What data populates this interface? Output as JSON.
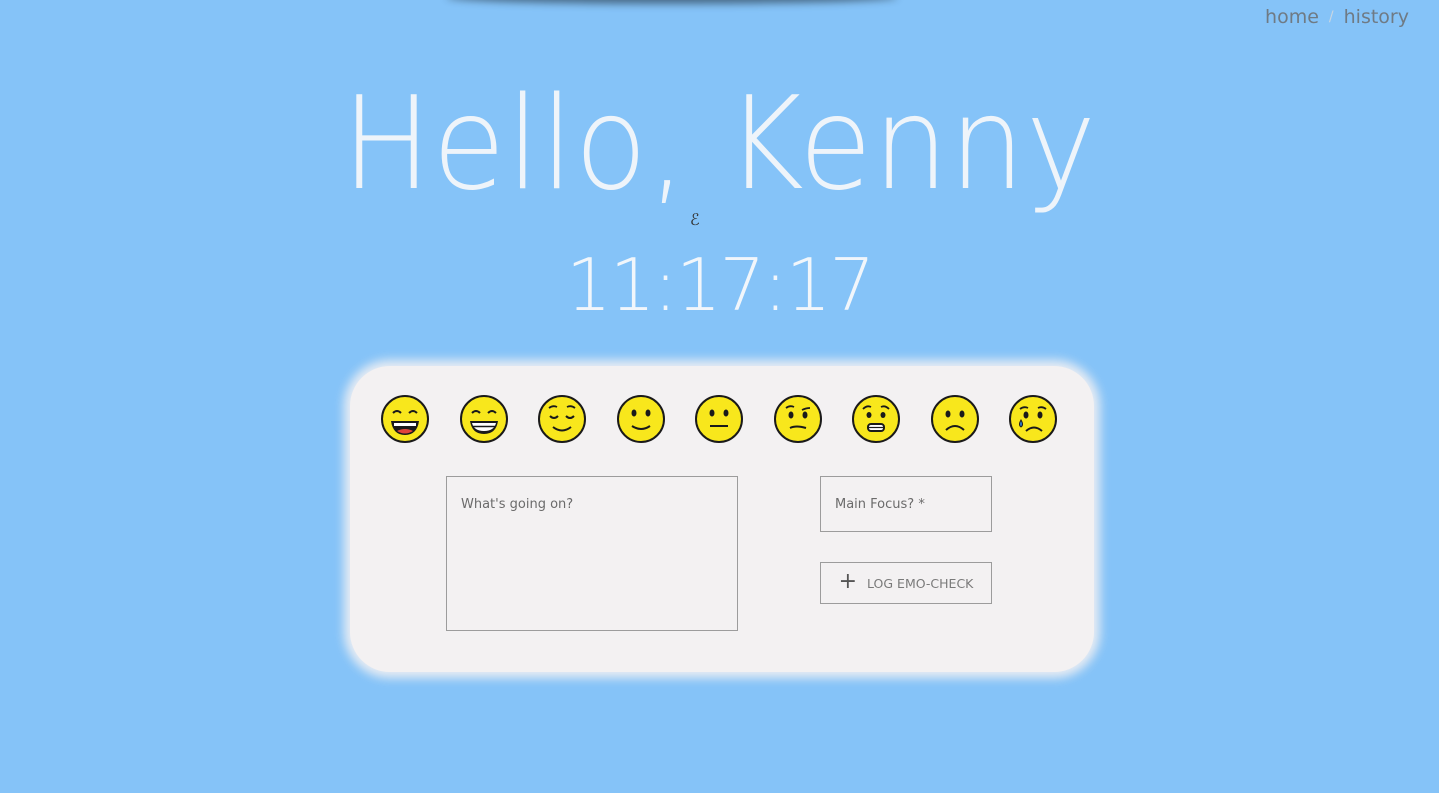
{
  "nav": {
    "home": "home",
    "separator": "/",
    "history": "history"
  },
  "greeting": "Hello, Kenny",
  "clock": "11:17:17",
  "moods": [
    "grinning-face-icon",
    "beaming-face-icon",
    "relieved-face-icon",
    "slightly-smiling-face-icon",
    "neutral-face-icon",
    "raised-eyebrow-face-icon",
    "grimacing-face-icon",
    "frowning-face-icon",
    "sad-tear-face-icon"
  ],
  "form": {
    "note_placeholder": "What's going on?",
    "focus_placeholder": "Main Focus? *",
    "submit_label": "LOG EMO-CHECK",
    "submit_icon": "plus-icon"
  },
  "colors": {
    "background": "#85c3f8",
    "card": "#f3f1f2",
    "emoji": "#f8e71c"
  }
}
